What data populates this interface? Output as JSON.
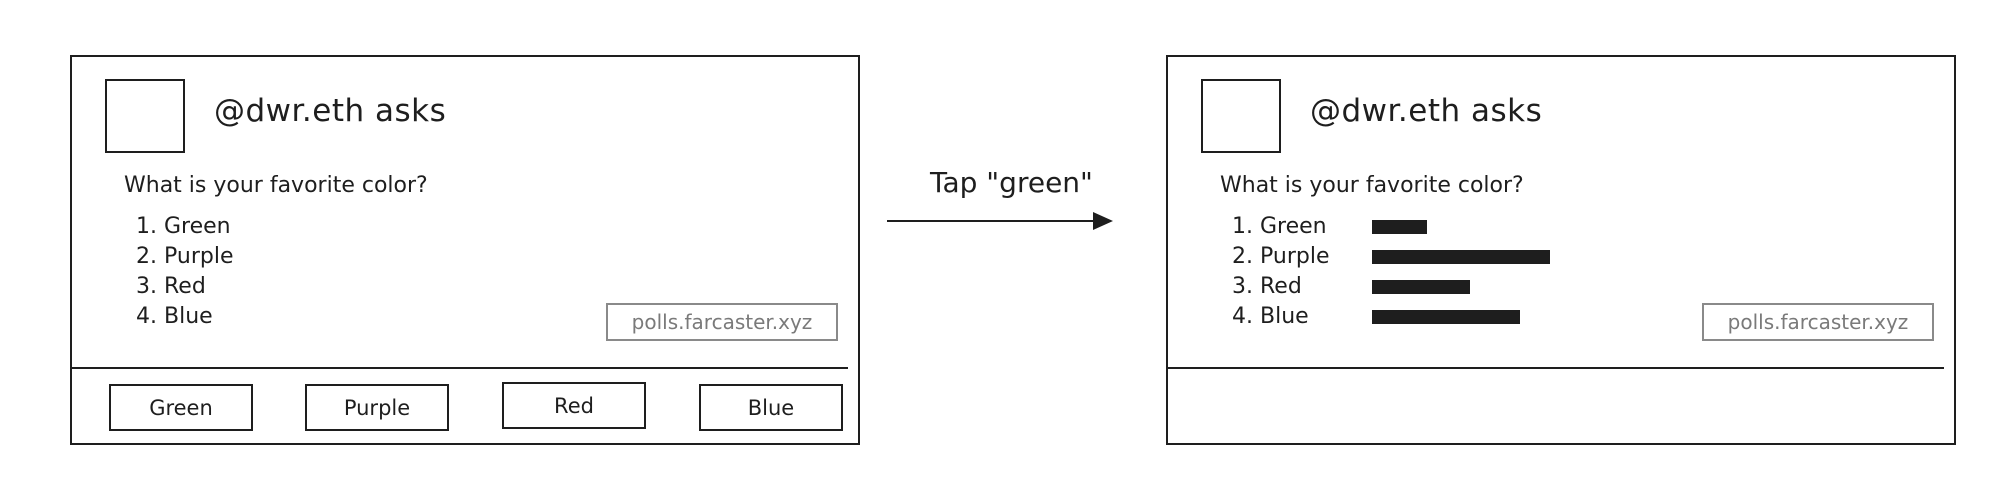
{
  "left_card": {
    "asker": "@dwr.eth asks",
    "question": "What is your favorite color?",
    "options": [
      {
        "num": "1.",
        "label": "Green"
      },
      {
        "num": "2.",
        "label": "Purple"
      },
      {
        "num": "3.",
        "label": "Red"
      },
      {
        "num": "4.",
        "label": "Blue"
      }
    ],
    "domain": "polls.farcaster.xyz",
    "buttons": [
      "Green",
      "Purple",
      "Red",
      "Blue"
    ]
  },
  "arrow": {
    "label": "Tap \"green\""
  },
  "right_card": {
    "asker": "@dwr.eth asks",
    "question": "What is your favorite color?",
    "options": [
      {
        "num": "1.",
        "label": "Green"
      },
      {
        "num": "2.",
        "label": "Purple"
      },
      {
        "num": "3.",
        "label": "Red"
      },
      {
        "num": "4.",
        "label": "Blue"
      }
    ],
    "result_shares": [
      0.31,
      1.0,
      0.55,
      0.83
    ],
    "domain": "polls.farcaster.xyz"
  }
}
